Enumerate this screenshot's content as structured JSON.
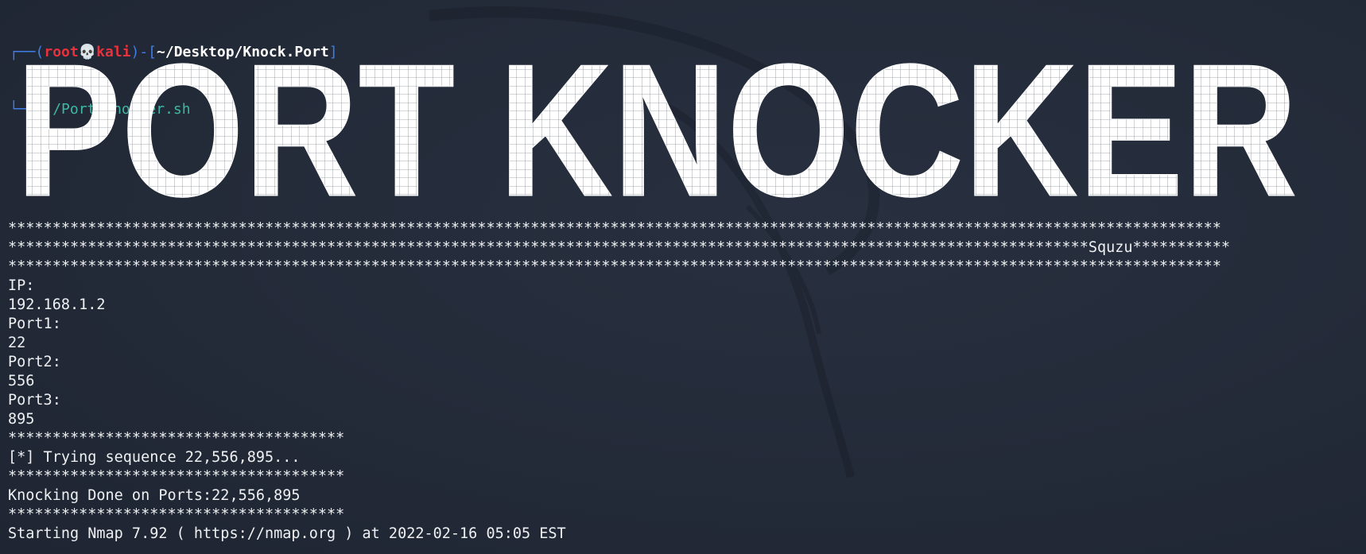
{
  "prompt": {
    "open_bracket": "┌──(",
    "user": "root",
    "skull_icon": "skull-icon",
    "host": "kali",
    "mid": ")-[",
    "path": "~/Desktop/Knock.Port",
    "close_bracket": "]",
    "line2_prefix": "└─",
    "hash": "#",
    "command": "./Port.knocker.sh"
  },
  "banner": {
    "text": "PORT KNOCKER"
  },
  "output": {
    "lines": [
      "*****************************************************************************************************************************************",
      "**************************************************************************************************************************Squzu***********",
      "*****************************************************************************************************************************************",
      "IP:",
      "192.168.1.2",
      "Port1:",
      "22",
      "Port2:",
      "556",
      "Port3:",
      "895",
      "**************************************",
      "[*] Trying sequence 22,556,895...",
      "**************************************",
      "Knocking Done on Ports:22,556,895",
      "**************************************",
      "Starting Nmap 7.92 ( https://nmap.org ) at 2022-02-16 05:05 EST"
    ]
  },
  "colors": {
    "background": "#232a38",
    "prompt_bracket": "#3f7ee8",
    "prompt_user": "#e8323b",
    "command": "#3fb7a4",
    "text": "#eef0f2"
  }
}
